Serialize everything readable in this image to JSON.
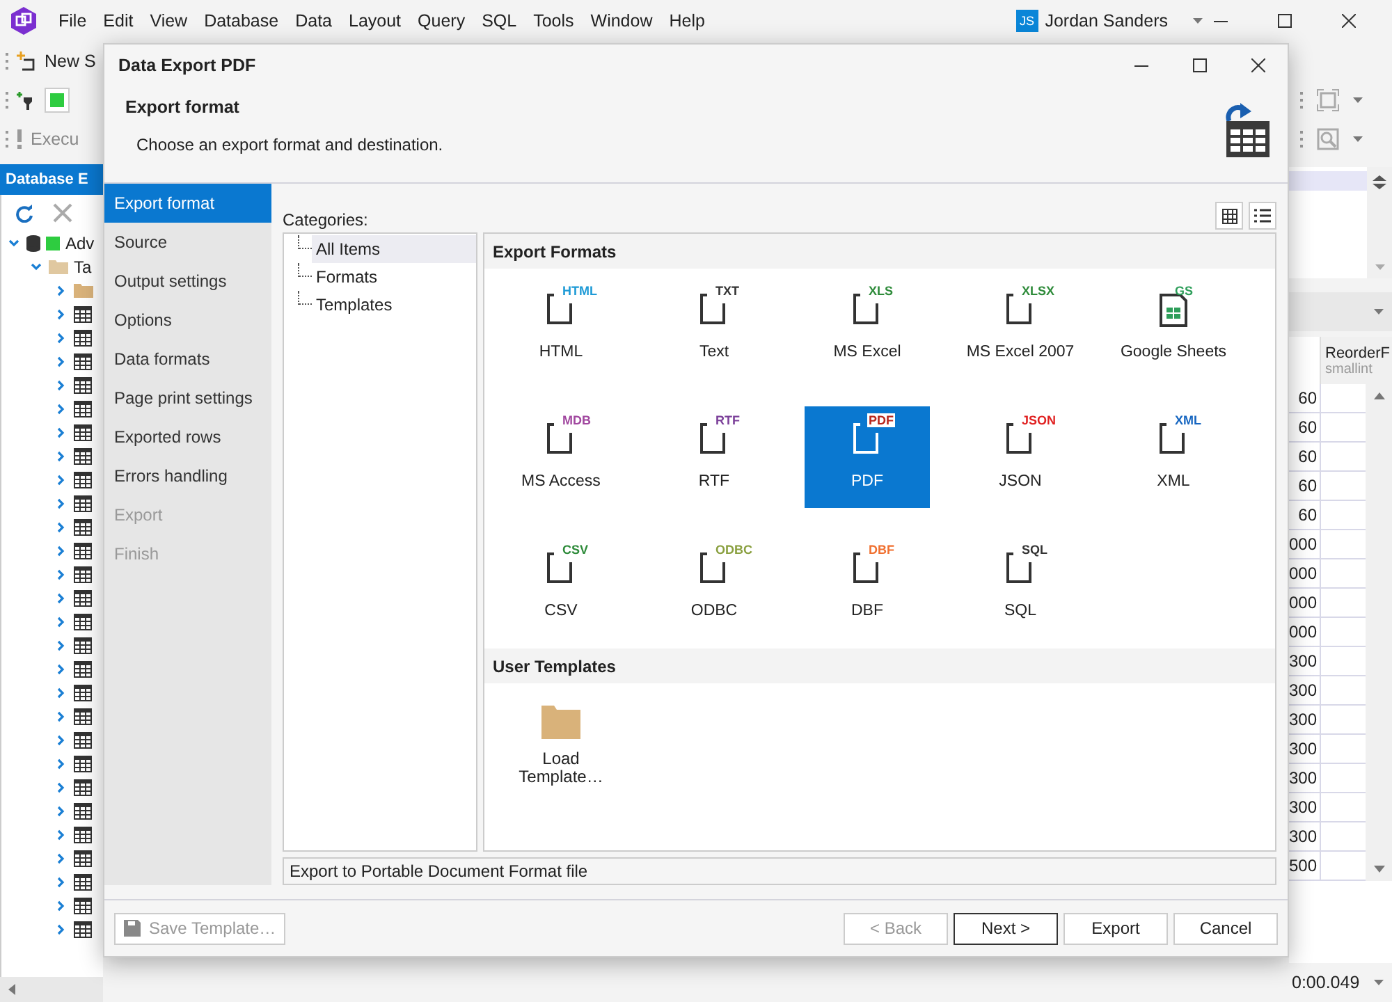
{
  "app": {
    "menu": [
      "File",
      "Edit",
      "View",
      "Database",
      "Data",
      "Layout",
      "Query",
      "SQL",
      "Tools",
      "Window",
      "Help"
    ],
    "user": {
      "initials": "JS",
      "name": "Jordan  Sanders"
    }
  },
  "background": {
    "toolbar": [
      "New S",
      "Execu"
    ],
    "explorer": {
      "title": "Database E",
      "tree": [
        {
          "label": "Adv",
          "expanded": true,
          "children": [
            {
              "label": "Ta",
              "expanded": true
            }
          ]
        }
      ]
    },
    "grid": {
      "column_header": "ReorderF",
      "column_type": "smallint",
      "cells": [
        "60",
        "60",
        "60",
        "60",
        "60",
        "000",
        "000",
        "000",
        "000",
        "300",
        "300",
        "300",
        "300",
        "300",
        "300",
        "300",
        "500"
      ],
      "footer": "0:00.049"
    }
  },
  "dialog": {
    "title": "Data Export PDF",
    "header": {
      "title": "Export format",
      "subtitle": "Choose an export format and destination."
    },
    "steps": [
      {
        "label": "Export format",
        "selected": true,
        "disabled": false
      },
      {
        "label": "Source",
        "selected": false,
        "disabled": false
      },
      {
        "label": "Output settings",
        "selected": false,
        "disabled": false
      },
      {
        "label": "Options",
        "selected": false,
        "disabled": false
      },
      {
        "label": "Data formats",
        "selected": false,
        "disabled": false
      },
      {
        "label": "Page print settings",
        "selected": false,
        "disabled": false
      },
      {
        "label": "Exported rows",
        "selected": false,
        "disabled": false
      },
      {
        "label": "Errors handling",
        "selected": false,
        "disabled": false
      },
      {
        "label": "Export",
        "selected": false,
        "disabled": true
      },
      {
        "label": "Finish",
        "selected": false,
        "disabled": true
      }
    ],
    "categories_label": "Categories:",
    "categories": [
      {
        "label": "All Items",
        "selected": true
      },
      {
        "label": "Formats",
        "selected": false
      },
      {
        "label": "Templates",
        "selected": false
      }
    ],
    "groups": [
      {
        "title": "Export Formats",
        "items": [
          {
            "label": "HTML",
            "badge": "HTML",
            "color": "#1e9ad6",
            "kind": "doc",
            "selected": false
          },
          {
            "label": "Text",
            "badge": "TXT",
            "color": "#333333",
            "kind": "doc",
            "selected": false
          },
          {
            "label": "MS Excel",
            "badge": "XLS",
            "color": "#2e8b3a",
            "kind": "doc",
            "selected": false
          },
          {
            "label": "MS Excel 2007",
            "badge": "XLSX",
            "color": "#2e8b3a",
            "kind": "doc",
            "selected": false
          },
          {
            "label": "Google Sheets",
            "badge": "GS",
            "color": "#2e9e5a",
            "kind": "sheet",
            "selected": false
          },
          {
            "label": "MS Access",
            "badge": "MDB",
            "color": "#a1479f",
            "kind": "doc",
            "selected": false
          },
          {
            "label": "RTF",
            "badge": "RTF",
            "color": "#7b3f99",
            "kind": "doc",
            "selected": false
          },
          {
            "label": "PDF",
            "badge": "PDF",
            "color": "#b8261c",
            "kind": "doc",
            "selected": true
          },
          {
            "label": "JSON",
            "badge": "JSON",
            "color": "#e02020",
            "kind": "doc",
            "selected": false
          },
          {
            "label": "XML",
            "badge": "XML",
            "color": "#1565c0",
            "kind": "doc",
            "selected": false
          },
          {
            "label": "CSV",
            "badge": "CSV",
            "color": "#2e8b3a",
            "kind": "doc",
            "selected": false
          },
          {
            "label": "ODBC",
            "badge": "ODBC",
            "color": "#8aa040",
            "kind": "doc",
            "selected": false
          },
          {
            "label": "DBF",
            "badge": "DBF",
            "color": "#f07030",
            "kind": "doc",
            "selected": false
          },
          {
            "label": "SQL",
            "badge": "SQL",
            "color": "#333333",
            "kind": "doc",
            "selected": false
          }
        ]
      },
      {
        "title": "User Templates",
        "items": [
          {
            "label": "Load Template…",
            "kind": "folder",
            "selected": false
          }
        ]
      }
    ],
    "description": "Export to Portable Document Format file",
    "save_button": {
      "label": "Save Template…",
      "disabled": true
    },
    "buttons": [
      {
        "label": "< Back",
        "disabled": true,
        "default": false
      },
      {
        "label": "Next >",
        "disabled": false,
        "default": true
      },
      {
        "label": "Export",
        "disabled": false,
        "default": false
      },
      {
        "label": "Cancel",
        "disabled": false,
        "default": false
      }
    ]
  }
}
